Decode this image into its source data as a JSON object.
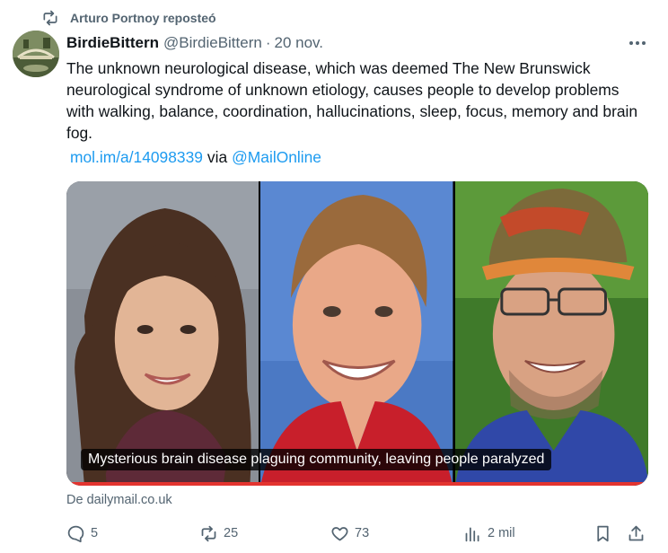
{
  "repost": {
    "text": "Arturo Portnoy reposteó",
    "icon": "repost-icon"
  },
  "tweet": {
    "author_name": "BirdieBittern",
    "handle": "@BirdieBittern",
    "separator": "·",
    "date": "20 nov.",
    "text": "The unknown neurological disease, which was deemed The New Brunswick neurological syndrome of unknown etiology, causes people to develop problems with walking, balance, coordination, hallucinations, sleep, focus, memory and brain fog.",
    "link_url": "mol.im/a/14098339",
    "via_text": "via",
    "via_mention": "@MailOnline"
  },
  "card": {
    "caption": "Mysterious brain disease plaguing community, leaving people paralyzed",
    "source": "De dailymail.co.uk"
  },
  "actions": {
    "replies": "5",
    "reposts": "25",
    "likes": "73",
    "views": "2 mil"
  },
  "colors": {
    "link": "#1d9bf0",
    "secondary_text": "#536471",
    "primary_text": "#0f1419",
    "accent_red": "#e3342f"
  }
}
